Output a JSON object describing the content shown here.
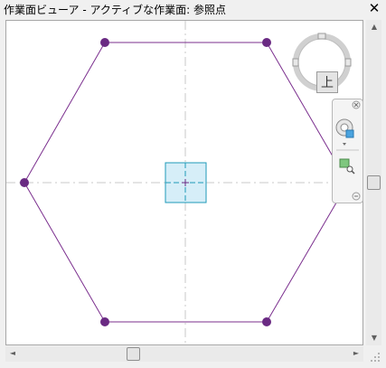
{
  "window": {
    "title": "作業面ビューア - アクティブな作業面: 参照点",
    "close_glyph": "✕"
  },
  "viewcube": {
    "face_label": "上",
    "compass_icon": "compass-ring-icon"
  },
  "navigation_bar": {
    "close_icon": "close-small-icon",
    "steering_wheel_icon": "steering-wheel-icon",
    "dropdown_icon": "chevron-down-icon",
    "zoom_icon": "zoom-region-icon",
    "collapse_icon": "collapse-icon"
  },
  "colors": {
    "hexagon": "#7b2f8e",
    "vertex": "#6a2a83",
    "workplane_fill": "#d6eef8",
    "workplane_stroke": "#1f9ab8",
    "axis_dash": "#c8c8c8"
  },
  "scrollbars": {
    "vertical_up": "▲",
    "vertical_down": "▼",
    "horizontal_left": "◄",
    "horizontal_right": "►"
  }
}
